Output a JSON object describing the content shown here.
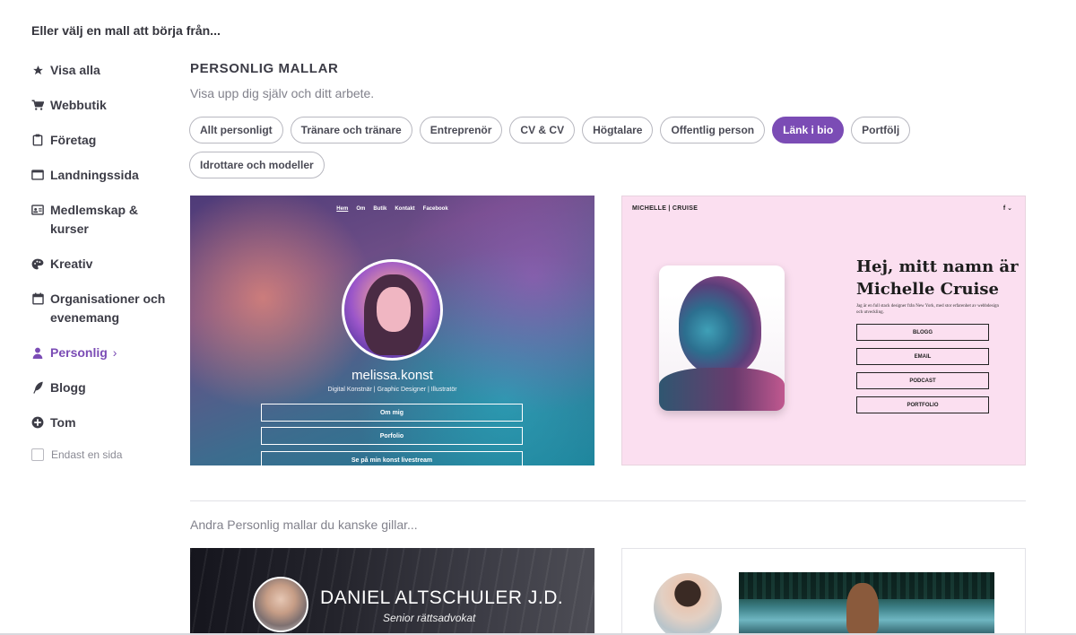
{
  "page": {
    "heading": "Eller välj en mall att börja från..."
  },
  "sidebar": {
    "items": [
      {
        "label": "Visa alla",
        "icon": "star-icon"
      },
      {
        "label": "Webbutik",
        "icon": "cart-icon"
      },
      {
        "label": "Företag",
        "icon": "clipboard-icon"
      },
      {
        "label": "Landningssida",
        "icon": "browser-window-icon"
      },
      {
        "label": "Medlemskap & kurser",
        "icon": "id-card-icon"
      },
      {
        "label": "Kreativ",
        "icon": "palette-icon"
      },
      {
        "label": "Organisationer och evenemang",
        "icon": "calendar-icon"
      },
      {
        "label": "Personlig",
        "icon": "person-icon",
        "active": true
      },
      {
        "label": "Blogg",
        "icon": "quill-icon"
      },
      {
        "label": "Tom",
        "icon": "plus-circle-icon"
      }
    ],
    "single_page_label": "Endast en sida",
    "active_color": "#7b4cb5"
  },
  "main": {
    "title": "PERSONLIG MALLAR",
    "subtitle": "Visa upp dig själv och ditt arbete.",
    "chips": [
      {
        "label": "Allt personligt"
      },
      {
        "label": "Tränare och tränare"
      },
      {
        "label": "Entreprenör"
      },
      {
        "label": "CV & CV"
      },
      {
        "label": "Högtalare"
      },
      {
        "label": "Offentlig person"
      },
      {
        "label": "Länk i bio",
        "active": true
      },
      {
        "label": "Portfölj"
      },
      {
        "label": "Idrottare och modeller"
      }
    ],
    "templates": [
      {
        "nav": [
          "Hem",
          "Om",
          "Butik",
          "Kontakt",
          "Facebook"
        ],
        "name": "melissa.konst",
        "role": "Digital Konstnär | Graphic Designer | Illustratör",
        "buttons": [
          "Om mig",
          "Porfolio",
          "Se på min konst livestream"
        ]
      },
      {
        "brand": "MICHELLE  |  CRUISE",
        "social": "f ⌄",
        "title_line1": "Hej, mitt namn är",
        "title_line2": "Michelle Cruise",
        "text": "Jag är en full stack designer från New York, med stor erfarenhet av webbdesign och utveckling.",
        "buttons": [
          "BLOGG",
          "EMAIL",
          "PODCAST",
          "PORTFOLIO"
        ]
      }
    ],
    "more_title": "Andra Personlig mallar du kanske gillar...",
    "more_templates": [
      {
        "name": "DANIEL ALTSCHULER J.D.",
        "role": "Senior rättsadvokat"
      },
      {}
    ]
  }
}
